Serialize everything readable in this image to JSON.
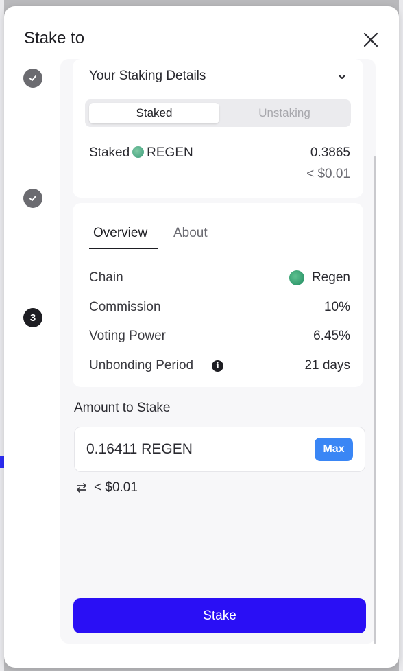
{
  "modal": {
    "title": "Stake to"
  },
  "stepper": {
    "step3_label": "3"
  },
  "staking_details": {
    "title": "Your Staking Details",
    "tabs": [
      "Staked",
      "Unstaking"
    ],
    "staked_label_prefix": "Staked",
    "token": "REGEN",
    "staked_amount": "0.3865",
    "staked_usd": "< $0.01"
  },
  "validator": {
    "tabs": [
      "Overview",
      "About"
    ],
    "rows": [
      {
        "label": "Chain",
        "value": "Regen"
      },
      {
        "label": "Commission",
        "value": "10%"
      },
      {
        "label": "Voting Power",
        "value": "6.45%"
      },
      {
        "label": "Unbonding Period",
        "value": "21 days"
      }
    ]
  },
  "amount": {
    "heading": "Amount to Stake",
    "input_value": "0.16411 REGEN",
    "max_label": "Max",
    "usd_equivalent": "< $0.01"
  },
  "stake_button_label": "Stake",
  "colors": {
    "accent": "#2a0ff5",
    "max_button": "#3a86f5",
    "regen_token": "#3b9c7a"
  }
}
